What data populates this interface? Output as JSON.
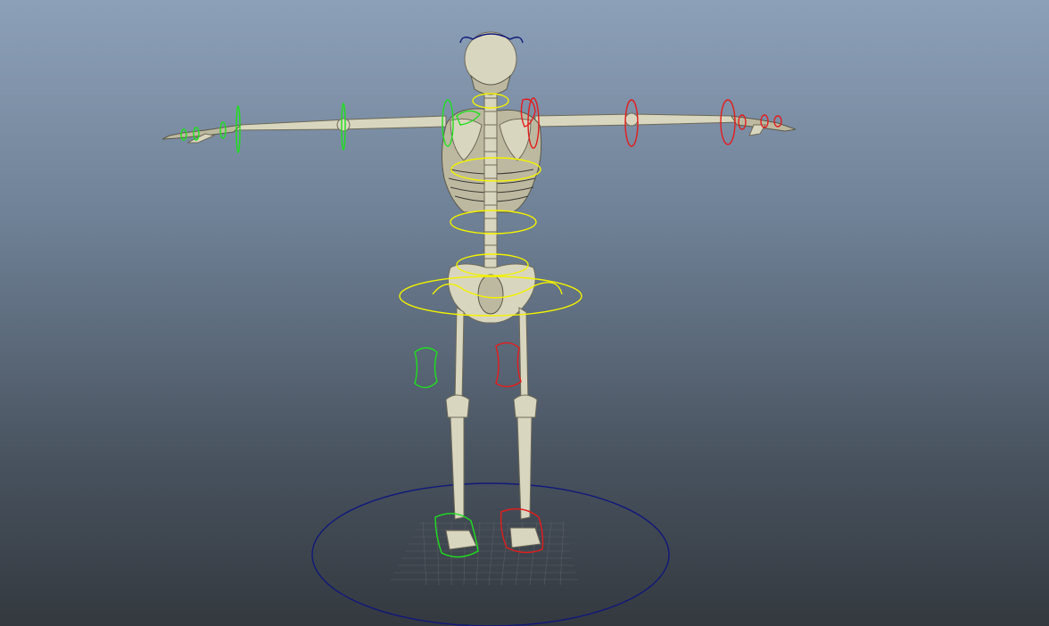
{
  "viewport": {
    "background_top": "#8ca0b8",
    "background_bottom": "#34393f"
  },
  "colors": {
    "bone": "#d9d6c0",
    "bone_shadow": "#bdb9a1",
    "ctrl_center": "#f2f200",
    "ctrl_left": "#1ee01e",
    "ctrl_right": "#e41c1c",
    "ctrl_global": "#10187a",
    "grid": "#5a5e62"
  }
}
